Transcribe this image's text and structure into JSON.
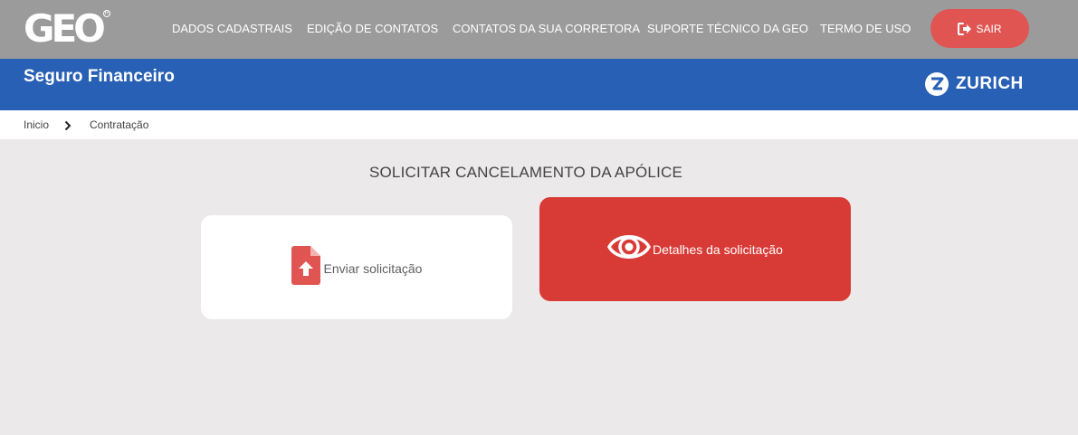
{
  "header": {
    "logo_text": "GEO",
    "logo_reg": "R",
    "nav": [
      {
        "label": "DADOS CADASTRAIS"
      },
      {
        "label": "EDIÇÃO DE CONTATOS"
      },
      {
        "label": "CONTATOS DA SUA CORRETORA"
      },
      {
        "label": "SUPORTE TÉCNICO DA GEO"
      },
      {
        "label": "TERMO DE USO"
      }
    ],
    "logout_label": "SAIR",
    "logout_icon": "logout-icon"
  },
  "banner": {
    "title": "Seguro Financeiro",
    "brand": "ZURICH",
    "brand_icon": "zurich-logo-icon"
  },
  "breadcrumb": {
    "items": [
      "Inicio",
      "Contratação"
    ],
    "separator_icon": "chevron-right-icon"
  },
  "main": {
    "title": "SOLICITAR CANCELAMENTO DA APÓLICE",
    "cards": [
      {
        "label": "Enviar solicitação",
        "icon": "file-upload-icon"
      },
      {
        "label": "Detalhes da solicitação",
        "icon": "eye-icon"
      }
    ]
  },
  "colors": {
    "topbar": "#9b9b9b",
    "banner": "#2760b4",
    "accent_red": "#d83a35",
    "logout_red": "#e05552",
    "background": "#ebe9e9"
  }
}
